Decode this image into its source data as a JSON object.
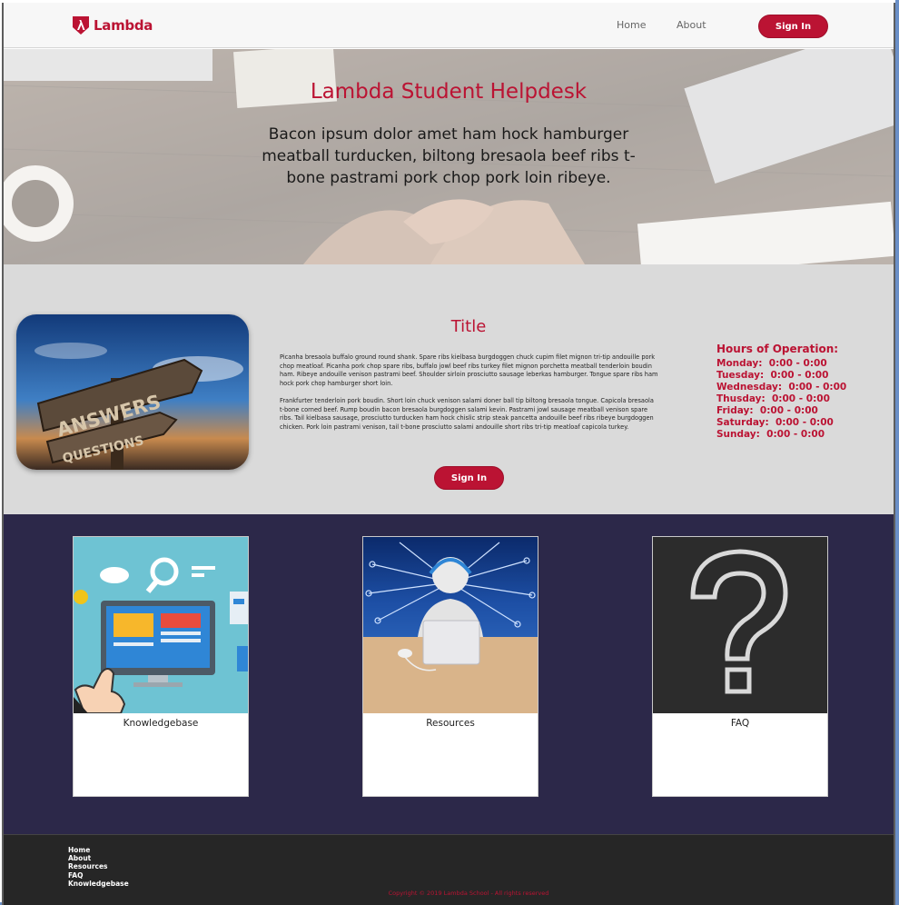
{
  "brand": {
    "name": "Lambda",
    "color": "#bb1333"
  },
  "nav": {
    "home": "Home",
    "about": "About",
    "signin": "Sign In"
  },
  "hero": {
    "title": "Lambda Student Helpdesk",
    "text": "Bacon ipsum dolor amet ham hock hamburger meatball turducken, biltong bresaola beef ribs t-bone pastrami pork chop pork loin ribeye.",
    "bg_image_desc": "desk-handshake-photo"
  },
  "info": {
    "image_desc": "answers-questions-signpost-photo",
    "title": "Title",
    "paragraphs": [
      "Picanha bresaola buffalo ground round shank. Spare ribs kielbasa burgdoggen chuck cupim filet mignon tri-tip andouille pork chop meatloaf. Picanha pork chop spare ribs, buffalo jowl beef ribs turkey filet mignon porchetta meatball tenderloin boudin ham. Ribeye andouille venison pastrami beef. Shoulder sirloin prosciutto sausage leberkas hamburger. Tongue spare ribs ham hock pork chop hamburger short loin.",
      "Frankfurter tenderloin pork boudin. Short loin chuck venison salami doner ball tip biltong bresaola tongue. Capicola bresaola t-bone corned beef. Rump boudin bacon bresaola burgdoggen salami kevin. Pastrami jowl sausage meatball venison spare ribs. Tail kielbasa sausage, prosciutto turducken ham hock chislic strip steak pancetta andouille beef ribs ribeye burgdoggen chicken. Pork loin pastrami venison, tail t-bone prosciutto salami andouille short ribs tri-tip meatloaf capicola turkey."
    ],
    "signin": "Sign In",
    "hours": {
      "title": "Hours of Operation:",
      "rows": [
        "Monday:  0:00 - 0:00",
        "Tuesday:  0:00 - 0:00",
        "Wednesday:  0:00 - 0:00",
        "Thusday:  0:00 - 0:00",
        "Friday:  0:00 - 0:00",
        "Saturday:  0:00 - 0:00",
        "Sunday:  0:00 - 0:00"
      ]
    }
  },
  "cards": [
    {
      "label": "Knowledgebase",
      "image_desc": "computer-hand-pointing-illustration"
    },
    {
      "label": "Resources",
      "image_desc": "3d-figure-headset-laptop"
    },
    {
      "label": "FAQ",
      "image_desc": "chalk-question-mark"
    }
  ],
  "footer": {
    "links": [
      "Home",
      "About",
      "Resources",
      "FAQ",
      "Knowledgebase"
    ],
    "copyright": "Copyright © 2019 Lambda School - All rights reserved"
  },
  "colors": {
    "accent": "#bb1333",
    "cards_bg": "#2c2849",
    "info_bg": "#dadada",
    "footer_bg": "#262626"
  }
}
